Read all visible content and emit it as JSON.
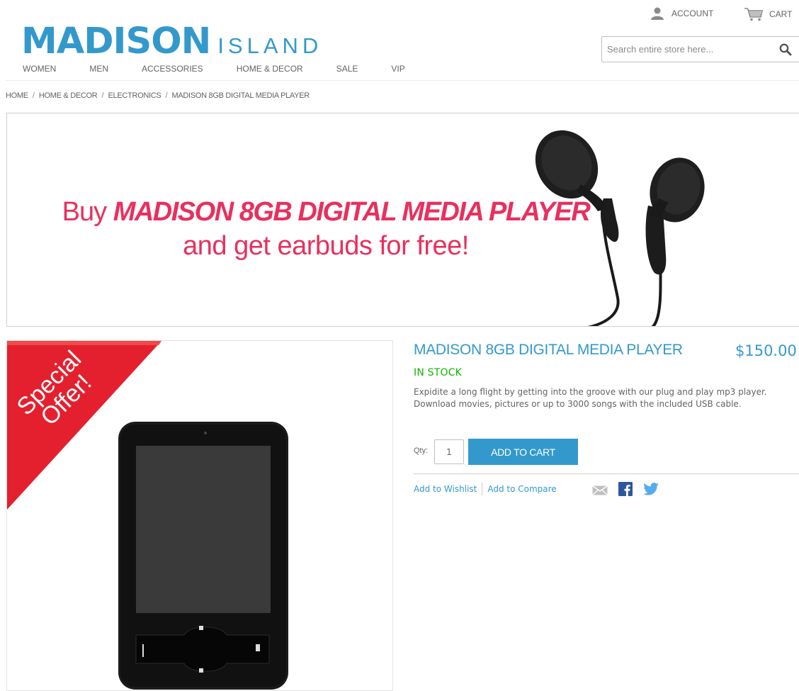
{
  "header": {
    "logo_main": "MADISON",
    "logo_sub": "ISLAND",
    "account_label": "ACCOUNT",
    "cart_label": "CART",
    "search_placeholder": "Search entire store here...",
    "nav": [
      "WOMEN",
      "MEN",
      "ACCESSORIES",
      "HOME & DECOR",
      "SALE",
      "VIP"
    ]
  },
  "breadcrumb": [
    "HOME",
    "HOME & DECOR",
    "ELECTRONICS",
    "MADISON 8GB DIGITAL MEDIA PLAYER"
  ],
  "banner": {
    "prefix": "Buy",
    "product": "MADISON 8GB DIGITAL MEDIA PLAYER",
    "line2": "and get earbuds for free!"
  },
  "ribbon": {
    "line1": "Special",
    "line2": "Offer!"
  },
  "product": {
    "name": "MADISON 8GB DIGITAL MEDIA PLAYER",
    "price": "$150.00",
    "stock": "IN STOCK",
    "description": "Expidite a long flight by getting into the groove with our plug and play mp3 player. Download movies, pictures or up to 3000 songs with the included USB cable.",
    "qty_label": "Qty:",
    "qty_value": "1",
    "add_to_cart": "ADD TO CART",
    "wishlist": "Add to Wishlist",
    "compare": "Add to Compare"
  },
  "colors": {
    "brand_blue": "#3399cc",
    "banner_pink": "#e8305e",
    "stock_green": "#11b400",
    "ribbon_red": "#e5202e"
  },
  "icons": {
    "account": "user-icon",
    "cart": "cart-icon",
    "search": "search-icon",
    "email": "email-icon",
    "facebook": "facebook-icon",
    "twitter": "twitter-icon"
  }
}
